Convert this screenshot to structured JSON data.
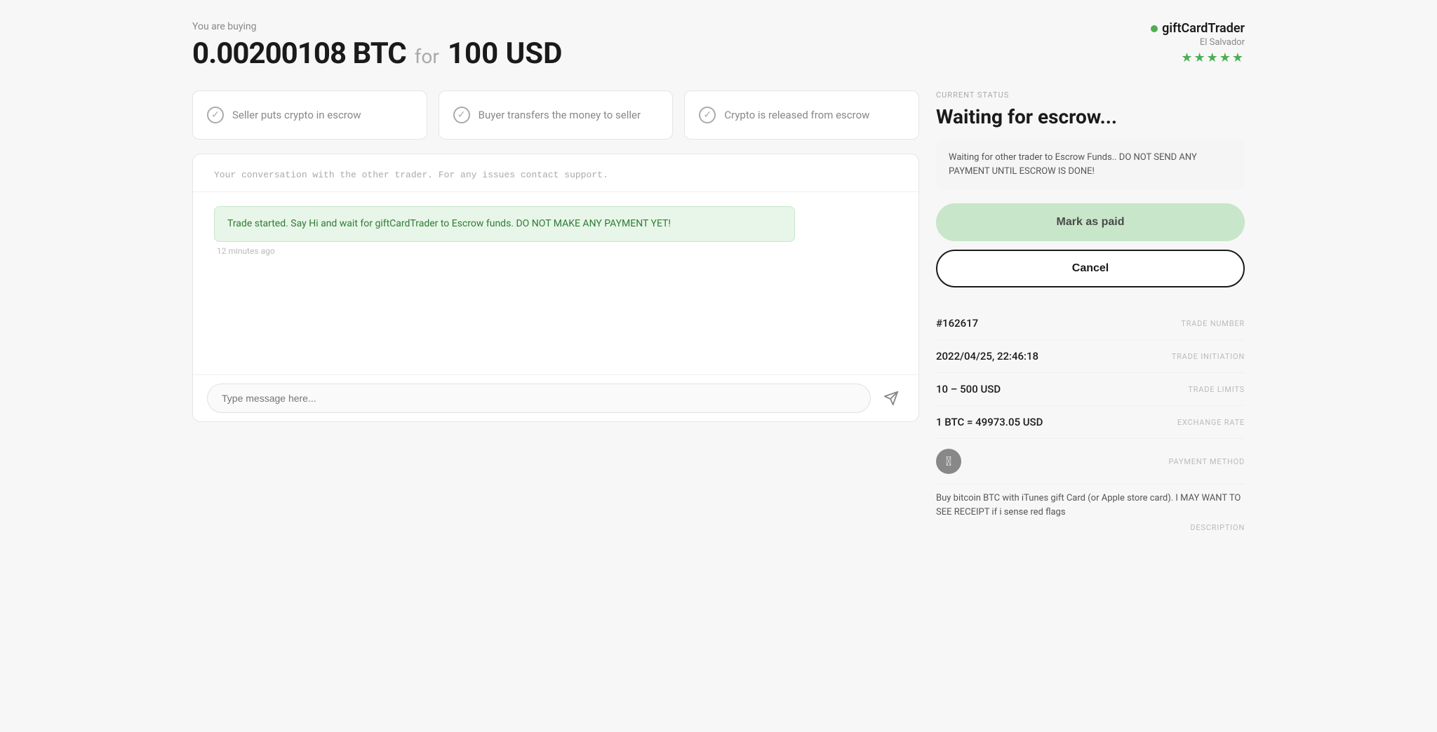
{
  "header": {
    "you_are_buying": "You are buying",
    "btc_amount": "0.00200108 BTC",
    "for_text": "for",
    "usd_amount": "100 USD",
    "trader_name": "giftCardTrader",
    "trader_location": "El Salvador",
    "stars": "★★★★★"
  },
  "steps": [
    {
      "label": "Seller puts crypto in escrow",
      "completed": true
    },
    {
      "label": "Buyer transfers the money to seller",
      "completed": true
    },
    {
      "label": "Crypto is released from escrow",
      "completed": true
    }
  ],
  "chat": {
    "header_note": "Your conversation with the other trader. For any issues contact support.",
    "message": "Trade started. Say Hi and wait for giftCardTrader to Escrow funds. DO NOT MAKE ANY PAYMENT YET!",
    "timestamp": "12 minutes ago",
    "input_placeholder": "Type message here..."
  },
  "status": {
    "label": "CURRENT STATUS",
    "title": "Waiting for escrow...",
    "warning": "Waiting for other trader to Escrow Funds.. DO NOT SEND ANY PAYMENT UNTIL ESCROW IS DONE!",
    "mark_paid_label": "Mark as paid",
    "cancel_label": "Cancel"
  },
  "trade_details": {
    "trade_number_value": "#162617",
    "trade_number_label": "TRADE NUMBER",
    "trade_initiation_value": "2022/04/25, 22:46:18",
    "trade_initiation_label": "TRADE INITIATION",
    "trade_limits_value": "10 – 500 USD",
    "trade_limits_label": "TRADE LIMITS",
    "exchange_rate_value": "1 BTC = 49973.05 USD",
    "exchange_rate_label": "EXCHANGE RATE",
    "payment_method_label": "PAYMENT METHOD",
    "description_text": "Buy bitcoin BTC with iTunes gift Card (or Apple store card). I MAY WANT TO SEE RECEIPT if i sense red flags",
    "description_label": "DESCRIPTION"
  }
}
